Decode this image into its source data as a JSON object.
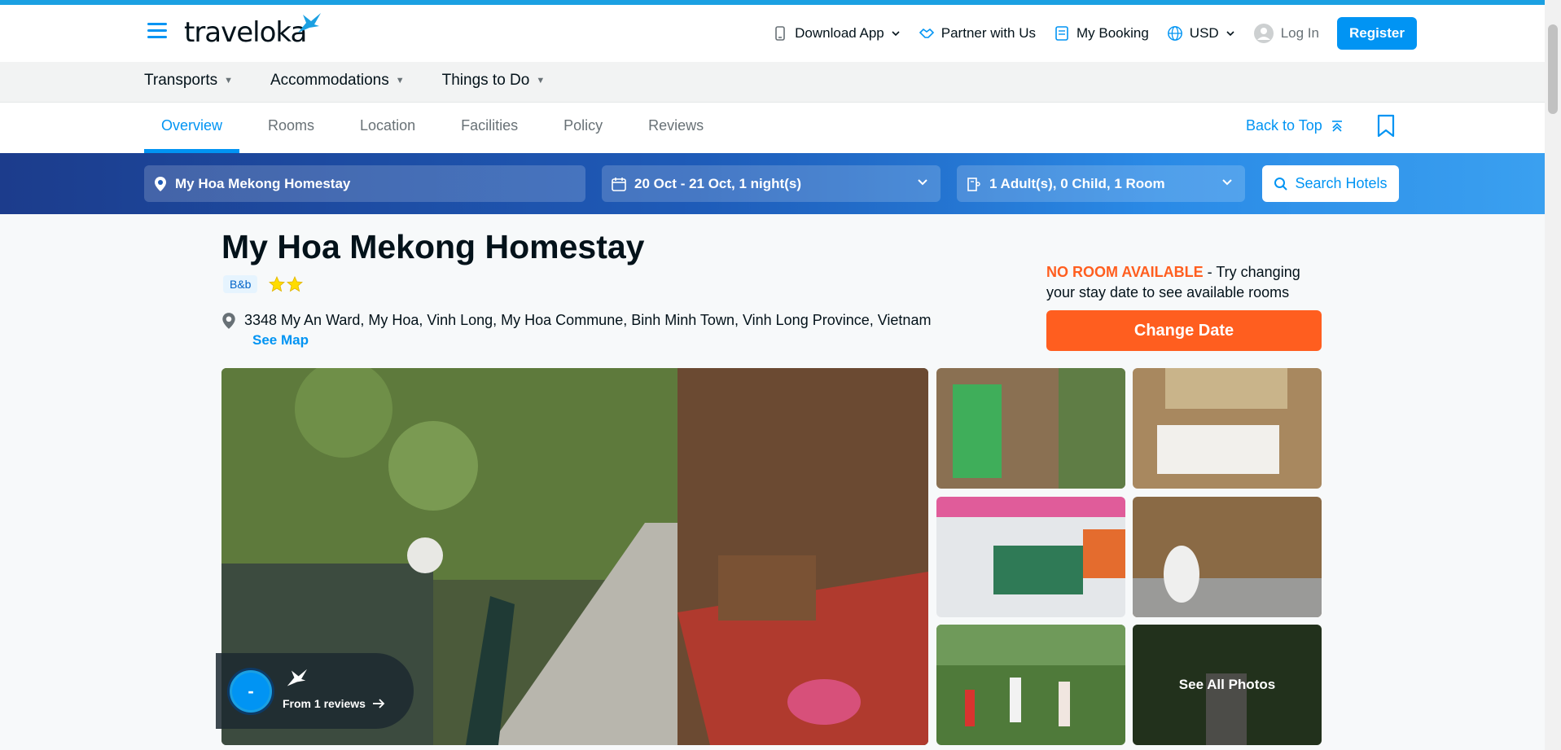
{
  "header": {
    "logo": "traveloka",
    "download_app": "Download App",
    "partner": "Partner with Us",
    "my_booking": "My Booking",
    "currency": "USD",
    "login": "Log In",
    "register": "Register"
  },
  "categories": [
    "Transports",
    "Accommodations",
    "Things to Do"
  ],
  "tabs": [
    "Overview",
    "Rooms",
    "Location",
    "Facilities",
    "Policy",
    "Reviews"
  ],
  "active_tab": "Overview",
  "back_to_top": "Back to Top",
  "search": {
    "destination": "My Hoa Mekong Homestay",
    "dates": "20 Oct - 21 Oct, 1 night(s)",
    "guests": "1 Adult(s), 0 Child, 1 Room",
    "button": "Search Hotels"
  },
  "hotel": {
    "name": "My Hoa Mekong Homestay",
    "type_badge": "B&b",
    "star_rating": 2,
    "address": "3348 My An Ward, My Hoa, Vinh Long, My Hoa Commune, Binh Minh Town, Vinh Long Province, Vietnam",
    "see_map": "See Map"
  },
  "availability": {
    "alert": "NO ROOM AVAILABLE",
    "message": " - Try changing your stay date to see available rooms",
    "change_date": "Change Date"
  },
  "reviews": {
    "score": "-",
    "count_text": "From 1 reviews"
  },
  "gallery": {
    "see_all": "See All Photos"
  },
  "colors": {
    "brand_blue": "#0194f3",
    "orange": "#ff5e1f",
    "star": "#ffdc00"
  }
}
